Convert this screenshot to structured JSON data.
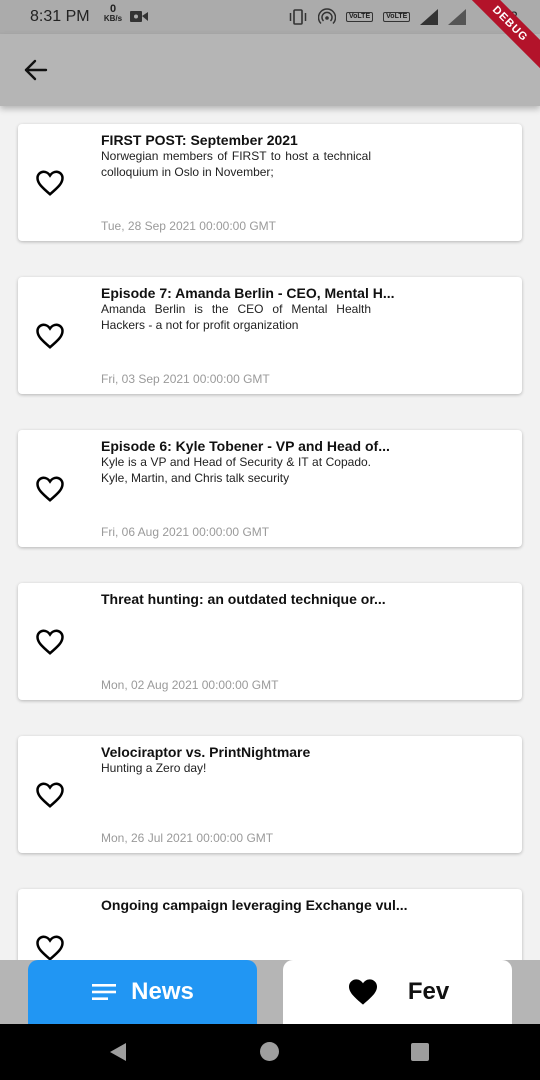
{
  "status_bar": {
    "time": "8:31 PM",
    "net_speed_value": "0",
    "net_speed_unit": "KB/s",
    "volte1": "VoLTE",
    "volte2": "VoLTE",
    "battery": "2"
  },
  "debug_banner": "DEBUG",
  "app_bar": {
    "back_icon": "arrow-back-icon"
  },
  "posts": [
    {
      "title": "FIRST POST: September 2021",
      "description": "Norwegian members of FIRST to host a technical colloquium in Oslo in November;",
      "date": "Tue, 28 Sep 2021 00:00:00 GMT"
    },
    {
      "title": "Episode 7: Amanda Berlin - CEO, Mental H...",
      "description": "Amanda Berlin is the CEO of Mental Health Hackers - a not for profit organization",
      "date": "Fri, 03 Sep 2021 00:00:00 GMT"
    },
    {
      "title": "Episode 6: Kyle Tobener - VP and Head of...",
      "description": "Kyle is a VP and Head of Security & IT at Copado. Kyle, Martin, and Chris talk security",
      "date": "Fri, 06 Aug 2021 00:00:00 GMT"
    },
    {
      "title": "Threat hunting: an outdated technique or...",
      "description": "",
      "date": "Mon, 02 Aug 2021 00:00:00 GMT"
    },
    {
      "title": "Velociraptor vs. PrintNightmare",
      "description": "Hunting a Zero day!",
      "date": "Mon, 26 Jul 2021 00:00:00 GMT"
    },
    {
      "title": "Ongoing campaign leveraging Exchange vul...",
      "description": "",
      "date": ""
    }
  ],
  "tabs": {
    "news_label": "News",
    "fev_label": "Fev",
    "active_color": "#2196f3"
  }
}
